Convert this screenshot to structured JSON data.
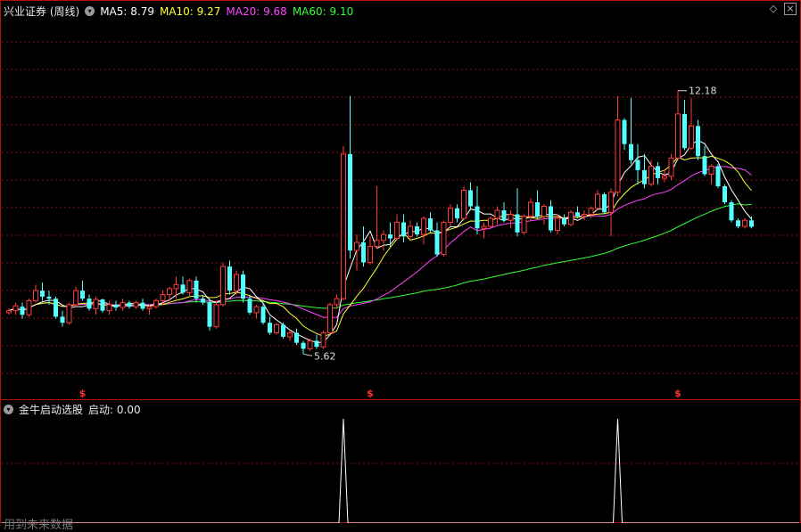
{
  "stock_title": "兴业证券 (周线)",
  "indicator_title": "金牛启动选股",
  "watermark": "用到未来数据",
  "signal_marker": "$",
  "colors": {
    "up": "#ff3b3b",
    "down": "#54ffff",
    "ma5": "#ffffff",
    "ma10": "#ffff33",
    "ma20": "#ff44ff",
    "ma60": "#33ff33",
    "grid": "#8a1010",
    "signal": "#ffffff"
  },
  "chart_data": [
    {
      "type": "candlestick",
      "title": "兴业证券 (周线)",
      "ylim": [
        4.85,
        13.95
      ],
      "grid": true,
      "legend": [
        {
          "name": "MA5",
          "label": "MA5: 8.79",
          "color": "#ffffff"
        },
        {
          "name": "MA10",
          "label": "MA10: 9.27",
          "color": "#ffff33"
        },
        {
          "name": "MA20",
          "label": "MA20: 9.68",
          "color": "#ff44ff"
        },
        {
          "name": "MA60",
          "label": "MA60: 9.10",
          "color": "#33ff33"
        }
      ],
      "annotations": [
        {
          "text": "12.18",
          "bar_index": 100,
          "value": 12.18
        },
        {
          "text": "5.62",
          "bar_index": 44,
          "value": 5.62
        }
      ],
      "signal_bars": [
        11,
        54,
        100
      ],
      "ohlc": [
        [
          6.65,
          6.75,
          6.6,
          6.7
        ],
        [
          6.7,
          6.9,
          6.6,
          6.82
        ],
        [
          6.8,
          6.9,
          6.5,
          6.6
        ],
        [
          6.6,
          7.0,
          6.55,
          6.95
        ],
        [
          6.95,
          7.35,
          6.9,
          7.2
        ],
        [
          7.2,
          7.4,
          6.95,
          7.05
        ],
        [
          7.05,
          7.2,
          6.85,
          7.0
        ],
        [
          7.0,
          7.05,
          6.5,
          6.55
        ],
        [
          6.55,
          6.7,
          6.3,
          6.4
        ],
        [
          6.4,
          6.9,
          6.35,
          6.85
        ],
        [
          6.85,
          7.3,
          6.8,
          7.2
        ],
        [
          7.2,
          7.45,
          6.95,
          7.0
        ],
        [
          7.0,
          7.1,
          6.7,
          6.75
        ],
        [
          6.75,
          7.05,
          6.6,
          6.98
        ],
        [
          6.98,
          7.0,
          6.65,
          6.7
        ],
        [
          6.7,
          6.95,
          6.6,
          6.85
        ],
        [
          6.85,
          6.95,
          6.7,
          6.78
        ],
        [
          6.78,
          7.0,
          6.7,
          6.9
        ],
        [
          6.9,
          6.95,
          6.75,
          6.8
        ],
        [
          6.8,
          6.95,
          6.75,
          6.9
        ],
        [
          6.9,
          7.0,
          6.7,
          6.75
        ],
        [
          6.75,
          6.85,
          6.6,
          6.8
        ],
        [
          6.8,
          7.0,
          6.75,
          6.95
        ],
        [
          6.95,
          7.2,
          6.85,
          7.1
        ],
        [
          7.1,
          7.3,
          6.95,
          7.25
        ],
        [
          7.25,
          7.55,
          7.0,
          7.35
        ],
        [
          7.35,
          7.55,
          7.1,
          7.15
        ],
        [
          7.15,
          7.5,
          7.05,
          7.45
        ],
        [
          7.45,
          7.55,
          6.9,
          7.0
        ],
        [
          7.0,
          7.1,
          6.85,
          6.9
        ],
        [
          6.9,
          7.0,
          6.2,
          6.3
        ],
        [
          6.3,
          6.95,
          6.25,
          6.85
        ],
        [
          6.85,
          7.9,
          6.8,
          7.8
        ],
        [
          7.8,
          7.95,
          7.1,
          7.2
        ],
        [
          7.2,
          7.7,
          7.1,
          7.6
        ],
        [
          7.6,
          7.7,
          6.9,
          7.0
        ],
        [
          7.0,
          7.1,
          6.6,
          6.65
        ],
        [
          6.65,
          6.85,
          6.5,
          6.8
        ],
        [
          6.8,
          6.9,
          6.35,
          6.4
        ],
        [
          6.4,
          6.55,
          6.1,
          6.15
        ],
        [
          6.15,
          6.4,
          6.1,
          6.35
        ],
        [
          6.35,
          6.4,
          6.0,
          6.05
        ],
        [
          6.05,
          6.2,
          5.95,
          6.15
        ],
        [
          6.15,
          6.25,
          5.85,
          5.9
        ],
        [
          5.9,
          5.95,
          5.62,
          5.75
        ],
        [
          5.75,
          6.0,
          5.7,
          5.95
        ],
        [
          5.95,
          6.1,
          5.75,
          5.8
        ],
        [
          5.8,
          6.2,
          5.75,
          6.15
        ],
        [
          6.15,
          6.9,
          6.1,
          6.85
        ],
        [
          6.85,
          7.1,
          6.75,
          7.0
        ],
        [
          7.0,
          10.8,
          6.95,
          10.6
        ],
        [
          10.6,
          12.05,
          8.0,
          8.2
        ],
        [
          8.2,
          8.6,
          7.7,
          8.4
        ],
        [
          8.4,
          8.8,
          7.8,
          7.9
        ],
        [
          7.9,
          8.55,
          7.85,
          8.3
        ],
        [
          8.3,
          9.8,
          8.25,
          8.45
        ],
        [
          8.45,
          8.7,
          8.2,
          8.6
        ],
        [
          8.6,
          8.9,
          8.3,
          8.5
        ],
        [
          8.5,
          9.1,
          8.45,
          8.9
        ],
        [
          8.9,
          9.1,
          8.4,
          8.55
        ],
        [
          8.55,
          8.95,
          8.5,
          8.8
        ],
        [
          8.8,
          8.9,
          8.55,
          8.6
        ],
        [
          8.6,
          9.05,
          8.35,
          9.0
        ],
        [
          9.0,
          9.15,
          8.65,
          8.7
        ],
        [
          8.7,
          8.9,
          8.05,
          8.1
        ],
        [
          8.1,
          8.95,
          8.05,
          8.9
        ],
        [
          8.9,
          9.35,
          8.8,
          9.25
        ],
        [
          9.25,
          9.35,
          8.9,
          9.0
        ],
        [
          9.0,
          9.8,
          8.95,
          9.7
        ],
        [
          9.7,
          9.9,
          9.2,
          9.3
        ],
        [
          9.3,
          9.8,
          8.6,
          8.75
        ],
        [
          8.75,
          8.9,
          8.5,
          8.8
        ],
        [
          8.8,
          9.05,
          8.75,
          9.0
        ],
        [
          9.0,
          9.3,
          8.85,
          9.2
        ],
        [
          9.2,
          9.4,
          8.9,
          8.95
        ],
        [
          8.95,
          9.2,
          8.75,
          9.1
        ],
        [
          9.1,
          9.75,
          8.55,
          8.65
        ],
        [
          8.65,
          9.1,
          8.6,
          9.05
        ],
        [
          9.05,
          9.5,
          8.95,
          9.4
        ],
        [
          9.4,
          9.7,
          9.0,
          9.05
        ],
        [
          9.05,
          9.35,
          8.85,
          9.3
        ],
        [
          9.3,
          9.45,
          8.65,
          8.7
        ],
        [
          8.7,
          9.1,
          8.6,
          9.0
        ],
        [
          9.0,
          9.1,
          8.8,
          8.85
        ],
        [
          8.85,
          9.2,
          8.8,
          9.15
        ],
        [
          9.15,
          9.3,
          9.0,
          9.05
        ],
        [
          9.05,
          9.2,
          8.95,
          9.1
        ],
        [
          9.1,
          9.3,
          9.0,
          9.25
        ],
        [
          9.25,
          9.7,
          9.2,
          9.6
        ],
        [
          9.6,
          9.65,
          9.1,
          9.15
        ],
        [
          9.15,
          9.75,
          8.55,
          9.65
        ],
        [
          9.65,
          12.05,
          9.55,
          11.45
        ],
        [
          11.45,
          11.5,
          10.7,
          10.85
        ],
        [
          10.85,
          12.0,
          10.35,
          10.45
        ],
        [
          10.45,
          10.85,
          9.85,
          10.2
        ],
        [
          10.2,
          10.6,
          9.75,
          9.85
        ],
        [
          9.85,
          10.45,
          9.8,
          10.3
        ],
        [
          10.3,
          10.4,
          9.85,
          10.0
        ],
        [
          10.0,
          10.2,
          9.9,
          10.05
        ],
        [
          10.05,
          10.6,
          9.95,
          10.5
        ],
        [
          10.5,
          12.18,
          10.45,
          11.6
        ],
        [
          11.6,
          11.95,
          10.7,
          10.75
        ],
        [
          10.75,
          12.0,
          10.7,
          11.3
        ],
        [
          11.3,
          11.45,
          10.45,
          10.55
        ],
        [
          10.55,
          10.8,
          10.05,
          10.1
        ],
        [
          10.1,
          10.35,
          9.85,
          10.3
        ],
        [
          10.3,
          10.35,
          9.75,
          9.8
        ],
        [
          9.8,
          9.85,
          9.35,
          9.4
        ],
        [
          9.4,
          9.45,
          8.9,
          8.95
        ],
        [
          8.95,
          9.0,
          8.75,
          8.8
        ],
        [
          8.8,
          9.0,
          8.75,
          8.95
        ],
        [
          8.95,
          9.05,
          8.75,
          8.79
        ]
      ]
    },
    {
      "type": "line",
      "title": "金牛启动选股",
      "series": [
        {
          "name": "启动",
          "label": "启动: 0.00"
        }
      ],
      "signal_bars": [
        50,
        91
      ],
      "ylim": [
        0,
        1
      ]
    }
  ]
}
